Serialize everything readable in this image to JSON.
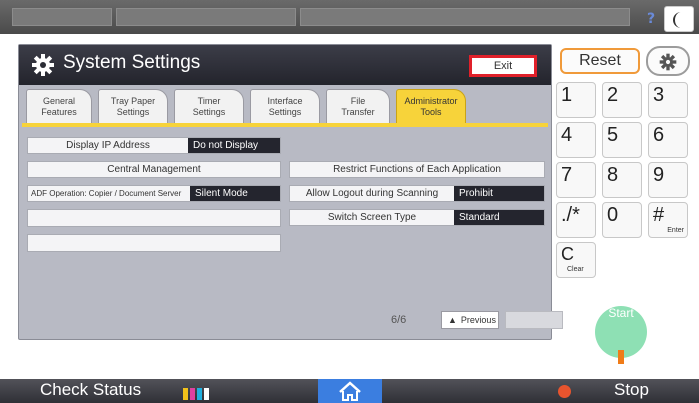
{
  "top_bar": {
    "help_label": "?",
    "night_mode_icon": "moon-icon"
  },
  "panel": {
    "title": "System Settings",
    "title_icon": "gear-icon",
    "exit_label": "Exit",
    "tabs": [
      {
        "label": "General\nFeatures",
        "active": false
      },
      {
        "label": "Tray Paper\nSettings",
        "active": false
      },
      {
        "label": "Timer\nSettings",
        "active": false
      },
      {
        "label": "Interface\nSettings",
        "active": false
      },
      {
        "label": "File\nTransfer",
        "active": false
      },
      {
        "label": "Administrator\nTools",
        "active": true
      }
    ],
    "left_items": [
      {
        "label": "Display IP Address",
        "value": "Do not Display"
      },
      {
        "label": "Central Management",
        "value": null
      },
      {
        "label": "ADF Operation: Copier / Document Server",
        "value": "Silent Mode"
      }
    ],
    "right_items": [
      {
        "label": "Restrict Functions of Each Application",
        "value": null
      },
      {
        "label": "Allow Logout during Scanning",
        "value": "Prohibit"
      },
      {
        "label": "Switch Screen Type",
        "value": "Standard"
      }
    ],
    "page_indicator": "6/6",
    "previous_label": "Previous",
    "next_label": ""
  },
  "keypad": {
    "reset_label": "Reset",
    "settings_icon": "gear-icon",
    "keys": [
      {
        "main": "1",
        "sub": ""
      },
      {
        "main": "2",
        "sub": ""
      },
      {
        "main": "3",
        "sub": ""
      },
      {
        "main": "4",
        "sub": ""
      },
      {
        "main": "5",
        "sub": ""
      },
      {
        "main": "6",
        "sub": ""
      },
      {
        "main": "7",
        "sub": ""
      },
      {
        "main": "8",
        "sub": ""
      },
      {
        "main": "9",
        "sub": ""
      },
      {
        "main": "./*",
        "sub": ""
      },
      {
        "main": "0",
        "sub": ""
      },
      {
        "main": "#",
        "sub": "Enter"
      },
      {
        "main": "C",
        "sub": "Clear"
      }
    ],
    "start_label": "Start"
  },
  "bottom_bar": {
    "check_status_label": "Check Status",
    "home_icon": "home-icon",
    "stop_label": "Stop"
  },
  "colors": {
    "accent_tab": "#f7d33a",
    "exit_border": "#e0202a",
    "reset_border": "#f09a3a",
    "start_button": "#8ee0b4",
    "home_tab": "#3b7ee0"
  }
}
